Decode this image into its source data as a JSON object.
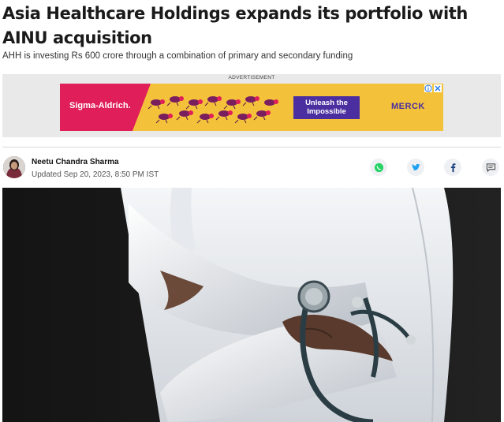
{
  "article": {
    "title": "Asia Healthcare Holdings expands its portfolio with AINU acquisition",
    "subtitle": "AHH is investing Rs 600 crore through a combination of primary and secondary funding"
  },
  "ad": {
    "label": "ADVERTISEMENT",
    "brand_left": "Sigma-Aldrich.",
    "cta": "Unleash the Impossible",
    "brand_right": "MERCK",
    "info_icon": "info-icon",
    "close_icon": "close-icon",
    "colors": {
      "red": "#e01e5a",
      "yellow": "#f3c23a",
      "purple": "#4b2ea0"
    }
  },
  "byline": {
    "author": "Neetu Chandra Sharma",
    "updated": "Updated Sep 20, 2023, 8:50 PM IST"
  },
  "share": {
    "icons": [
      "whatsapp-icon",
      "twitter-icon",
      "facebook-icon",
      "comment-icon"
    ],
    "colors": {
      "whatsapp": "#25d366",
      "twitter": "#1da1f2",
      "facebook": "#1a3e7a",
      "comment": "#444444"
    }
  },
  "hero": {
    "alt": "doctor-with-stethoscope-image"
  }
}
